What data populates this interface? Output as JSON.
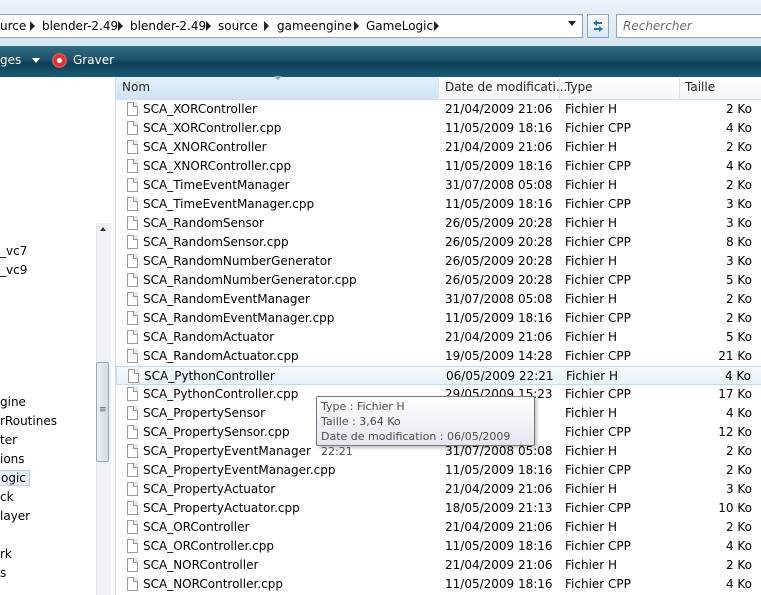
{
  "address": {
    "crumbs": [
      "urce",
      "blender-2.49",
      "blender-2.49",
      "source",
      "gameengine",
      "GameLogic"
    ],
    "search_placeholder": "Rechercher"
  },
  "toolbar": {
    "left_label": "ges",
    "burn_label": "Graver"
  },
  "nav": {
    "items": [
      "_vc7",
      "_vc9",
      "gine",
      "rRoutines",
      "ter",
      "ions",
      "ogic",
      "ck",
      "layer",
      "rk",
      "s"
    ],
    "selected": "ogic"
  },
  "columns": {
    "name": "Nom",
    "date": "Date de modificati...",
    "type": "Type",
    "size": "Taille"
  },
  "files": [
    {
      "name": "SCA_XORController",
      "date": "21/04/2009 21:06",
      "type": "Fichier H",
      "size": "2 Ko"
    },
    {
      "name": "SCA_XORController.cpp",
      "date": "11/05/2009 18:16",
      "type": "Fichier CPP",
      "size": "4 Ko"
    },
    {
      "name": "SCA_XNORController",
      "date": "21/04/2009 21:06",
      "type": "Fichier H",
      "size": "2 Ko"
    },
    {
      "name": "SCA_XNORController.cpp",
      "date": "11/05/2009 18:16",
      "type": "Fichier CPP",
      "size": "4 Ko"
    },
    {
      "name": "SCA_TimeEventManager",
      "date": "31/07/2008 05:08",
      "type": "Fichier H",
      "size": "2 Ko"
    },
    {
      "name": "SCA_TimeEventManager.cpp",
      "date": "11/05/2009 18:16",
      "type": "Fichier CPP",
      "size": "3 Ko"
    },
    {
      "name": "SCA_RandomSensor",
      "date": "26/05/2009 20:28",
      "type": "Fichier H",
      "size": "3 Ko"
    },
    {
      "name": "SCA_RandomSensor.cpp",
      "date": "26/05/2009 20:28",
      "type": "Fichier CPP",
      "size": "8 Ko"
    },
    {
      "name": "SCA_RandomNumberGenerator",
      "date": "26/05/2009 20:28",
      "type": "Fichier H",
      "size": "3 Ko"
    },
    {
      "name": "SCA_RandomNumberGenerator.cpp",
      "date": "26/05/2009 20:28",
      "type": "Fichier CPP",
      "size": "5 Ko"
    },
    {
      "name": "SCA_RandomEventManager",
      "date": "31/07/2008 05:08",
      "type": "Fichier H",
      "size": "2 Ko"
    },
    {
      "name": "SCA_RandomEventManager.cpp",
      "date": "11/05/2009 18:16",
      "type": "Fichier CPP",
      "size": "2 Ko"
    },
    {
      "name": "SCA_RandomActuator",
      "date": "21/04/2009 21:06",
      "type": "Fichier H",
      "size": "5 Ko"
    },
    {
      "name": "SCA_RandomActuator.cpp",
      "date": "19/05/2009 14:28",
      "type": "Fichier CPP",
      "size": "21 Ko"
    },
    {
      "name": "SCA_PythonController",
      "date": "06/05/2009 22:21",
      "type": "Fichier H",
      "size": "4 Ko"
    },
    {
      "name": "SCA_PythonController.cpp",
      "date": "29/05/2009 15:23",
      "type": "Fichier CPP",
      "size": "17 Ko"
    },
    {
      "name": "SCA_PropertySensor",
      "date": "",
      "type": "Fichier H",
      "size": "4 Ko"
    },
    {
      "name": "SCA_PropertySensor.cpp",
      "date": "",
      "type": "Fichier CPP",
      "size": "12 Ko"
    },
    {
      "name": "SCA_PropertyEventManager",
      "date": "31/07/2008 05:08",
      "type": "Fichier H",
      "size": "2 Ko"
    },
    {
      "name": "SCA_PropertyEventManager.cpp",
      "date": "11/05/2009 18:16",
      "type": "Fichier CPP",
      "size": "2 Ko"
    },
    {
      "name": "SCA_PropertyActuator",
      "date": "21/04/2009 21:06",
      "type": "Fichier H",
      "size": "3 Ko"
    },
    {
      "name": "SCA_PropertyActuator.cpp",
      "date": "18/05/2009 21:13",
      "type": "Fichier CPP",
      "size": "10 Ko"
    },
    {
      "name": "SCA_ORController",
      "date": "21/04/2009 21:06",
      "type": "Fichier H",
      "size": "2 Ko"
    },
    {
      "name": "SCA_ORController.cpp",
      "date": "11/05/2009 18:16",
      "type": "Fichier CPP",
      "size": "4 Ko"
    },
    {
      "name": "SCA_NORController",
      "date": "21/04/2009 21:06",
      "type": "Fichier H",
      "size": "2 Ko"
    },
    {
      "name": "SCA_NORController.cpp",
      "date": "11/05/2009 18:16",
      "type": "Fichier CPP",
      "size": "4 Ko"
    }
  ],
  "hovered_file": "SCA_PythonController",
  "tooltip": {
    "line1": "Type : Fichier H",
    "line2": "Taille : 3,64 Ko",
    "line3": "Date de modification : 06/05/2009 22:21"
  },
  "colors": {
    "toolbar": "#1d5168",
    "hover_row": "#e8f2fb",
    "tooltip_text": "#4c4c4c"
  }
}
